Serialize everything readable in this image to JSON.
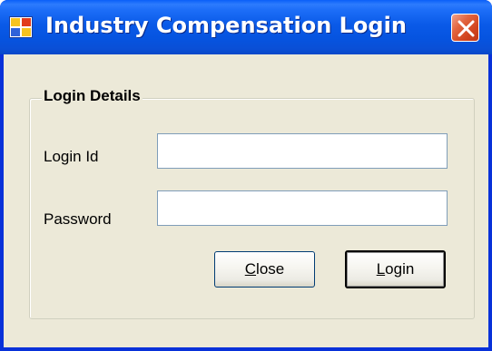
{
  "window": {
    "title": "Industry Compensation Login",
    "icon": "app-window-icon",
    "close_icon": "close-icon"
  },
  "group": {
    "label": "Login Details"
  },
  "fields": {
    "login_id": {
      "label": "Login Id",
      "value": ""
    },
    "password": {
      "label": "Password",
      "value": ""
    }
  },
  "buttons": {
    "close": {
      "mnemonic": "C",
      "rest": "lose"
    },
    "login": {
      "mnemonic": "L",
      "rest": "ogin"
    }
  },
  "colors": {
    "titlebar": "#0a5ae8",
    "client": "#ece9d8",
    "close_button": "#d1441d",
    "textbox_border": "#7f9db9"
  }
}
